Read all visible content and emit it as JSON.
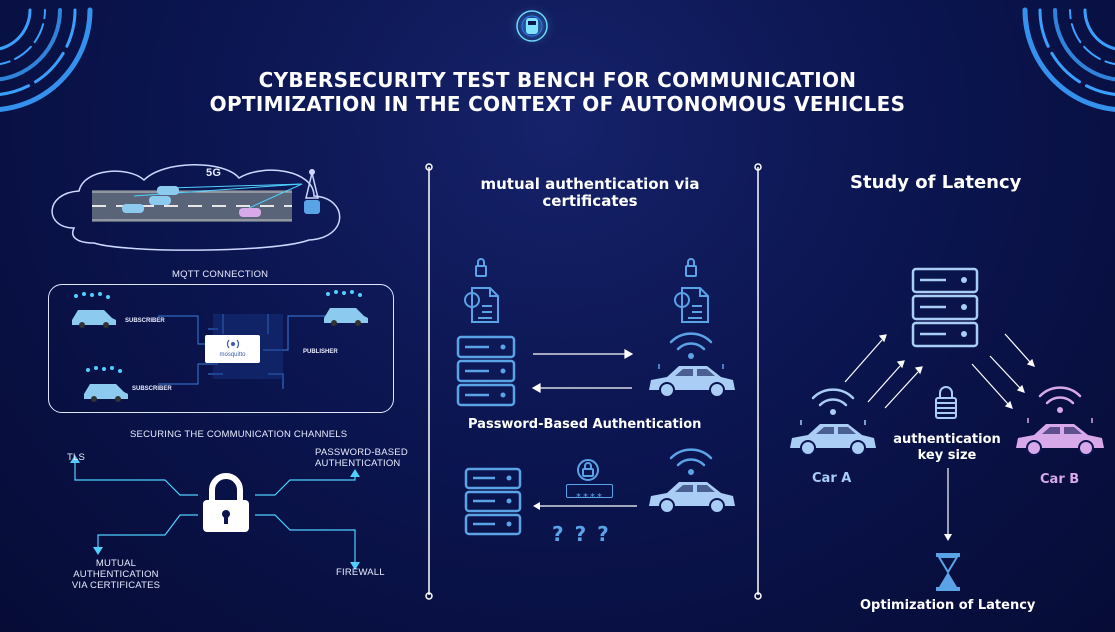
{
  "title_line1": "CYBERSECURITY TEST BENCH FOR COMMUNICATION",
  "title_line2": "OPTIMIZATION IN THE CONTEXT OF AUTONOMOUS VEHICLES",
  "left": {
    "badge_5g": "5G",
    "mqtt_label": "MQTT CONNECTION",
    "subscriber_1": "SUBSCRIBER",
    "subscriber_2": "SUBSCRIBER",
    "publisher": "PUBLISHER",
    "broker": "mosquitto",
    "securing_label": "SECURING THE COMMUNICATION CHANNELS",
    "tls": "TLS",
    "password_line1": "PASSWORD-BASED",
    "password_line2": "AUTHENTICATION",
    "mutual_line1": "MUTUAL AUTHENTICATION",
    "mutual_line2": "VIA CERTIFICATES",
    "firewall": "FIREWALL"
  },
  "middle": {
    "heading_line1": "mutual authentication via",
    "heading_line2": "certificates",
    "password_auth": "Password-Based Authentication",
    "password_dots": "****",
    "question_marks": "? ? ?"
  },
  "right": {
    "heading": "Study of Latency",
    "car_a": "Car A",
    "car_b": "Car B",
    "key_line1": "authentication",
    "key_line2": "key size",
    "optimization": "Optimization of Latency"
  },
  "colors": {
    "background": "#0b1550",
    "accent_blue": "#7db8f2",
    "car_a": "#a9cdf5",
    "car_b": "#d7a9e8",
    "icon_blue": "#5aa3e6"
  }
}
